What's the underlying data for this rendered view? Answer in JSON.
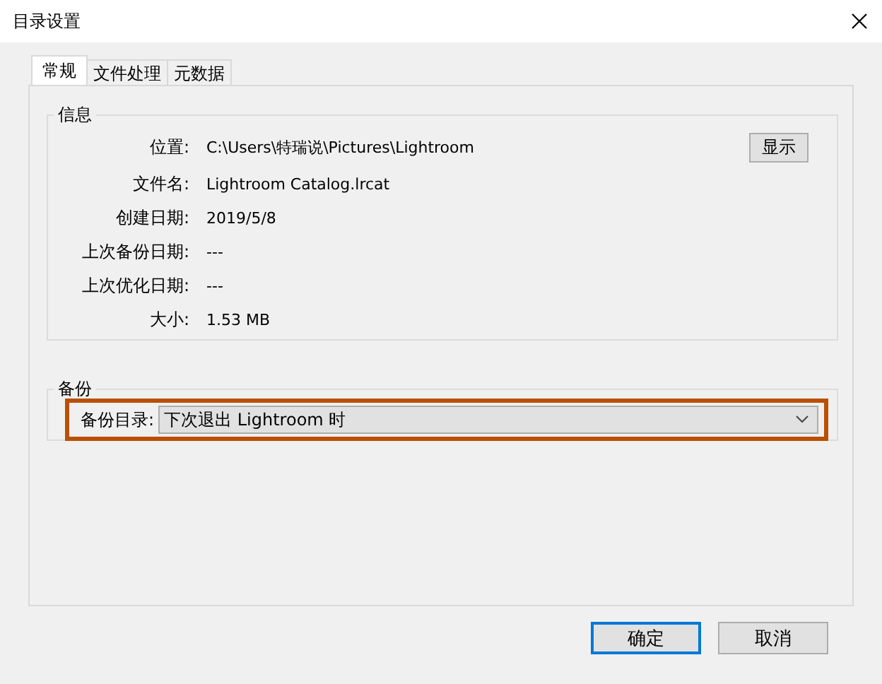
{
  "window": {
    "title": "目录设置"
  },
  "tabs": [
    {
      "label": "常规",
      "selected": true
    },
    {
      "label": "文件处理",
      "selected": false
    },
    {
      "label": "元数据",
      "selected": false
    }
  ],
  "info": {
    "title": "信息",
    "rows": [
      {
        "label": "位置:",
        "value": "C:\\Users\\特瑞说\\Pictures\\Lightroom"
      },
      {
        "label": "文件名:",
        "value": "Lightroom Catalog.lrcat"
      },
      {
        "label": "创建日期:",
        "value": "2019/5/8"
      },
      {
        "label": "上次备份日期:",
        "value": "---"
      },
      {
        "label": "上次优化日期:",
        "value": "---"
      },
      {
        "label": "大小:",
        "value": "1.53 MB"
      }
    ],
    "show_button": "显示"
  },
  "backup": {
    "title": "备份",
    "label": "备份目录:",
    "value": "下次退出 Lightroom 时"
  },
  "buttons": [
    {
      "label": "确定",
      "default": true
    },
    {
      "label": "取消",
      "default": false
    }
  ]
}
